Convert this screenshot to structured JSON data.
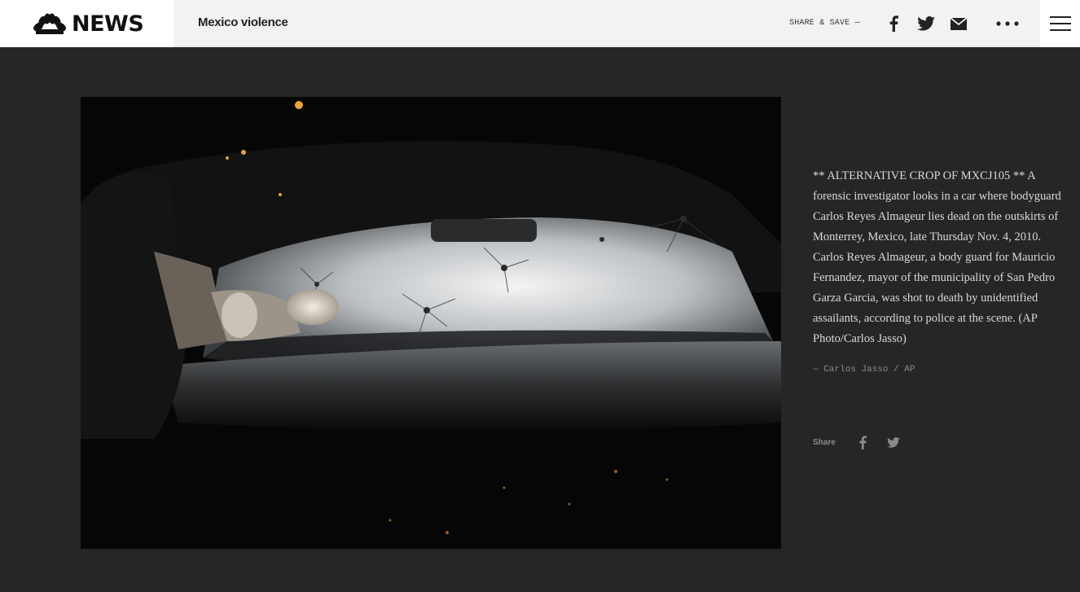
{
  "header": {
    "logo_text": "NEWS",
    "section_title": "Mexico violence",
    "share_save_label": "SHARE & SAVE —"
  },
  "icons": {
    "logo": "nbc-peacock-icon",
    "facebook": "facebook-icon",
    "twitter": "twitter-icon",
    "email": "email-icon",
    "more": "more-icon",
    "menu": "hamburger-menu-icon"
  },
  "caption": {
    "text": "** ALTERNATIVE CROP OF MXCJ105 ** A forensic investigator looks in a car where bodyguard Carlos Reyes Almageur lies dead on the outskirts of Monterrey, Mexico, late Thursday Nov. 4, 2010. Carlos Reyes Almageur, a body guard for Mauricio Fernandez, mayor of the municipality of San Pedro Garza Garcia, was shot to death by unidentified assailants, according to police at the scene. (AP Photo/Carlos Jasso)",
    "credit": "— Carlos Jasso / AP",
    "share_label": "Share"
  },
  "colors": {
    "page_bg": "#262626",
    "header_bg": "#f2f2f2"
  }
}
